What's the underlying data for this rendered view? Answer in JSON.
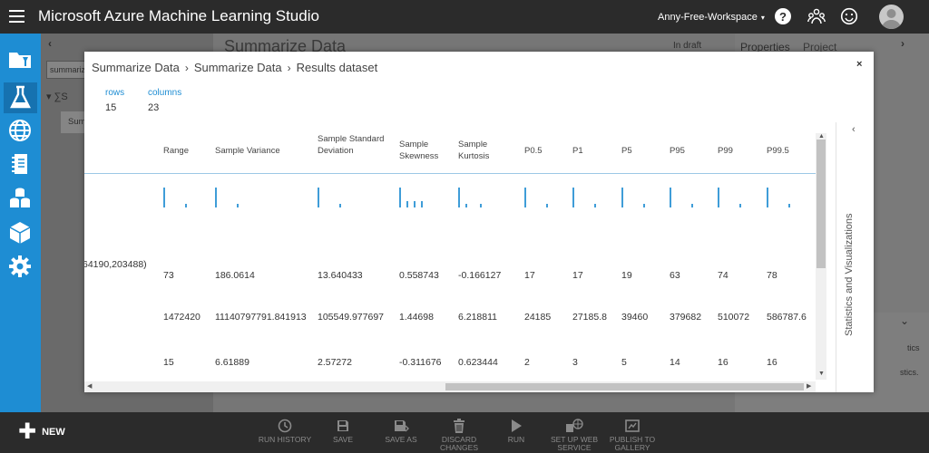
{
  "app": {
    "title": "Microsoft Azure Machine Learning Studio",
    "workspace": "Anny-Free-Workspace",
    "workspace_caret": "▾",
    "help_glyph": "?"
  },
  "background": {
    "search_value": "summariz",
    "tree_item": "S",
    "tree_selected": "Sum",
    "canvas_title": "Summarize Data",
    "status": "In draft",
    "tab_properties": "Properties",
    "tab_project": "Project",
    "props_text_1": "tics",
    "props_text_2": "stics."
  },
  "modal": {
    "breadcrumb": [
      "Summarize Data",
      "Summarize Data",
      "Results dataset"
    ],
    "breadcrumb_sep": "›",
    "close": "×",
    "rows_label": "rows",
    "rows_value": "15",
    "columns_label": "columns",
    "columns_value": "23",
    "side_panel_label": "Statistics and Visualizations",
    "side_panel_chevron": "‹",
    "columns": [
      {
        "header": "Range",
        "hist": [
          1,
          0,
          0,
          0.2
        ],
        "values": [
          "73",
          "1472420",
          "15"
        ]
      },
      {
        "header": "Sample Variance",
        "hist": [
          1,
          0,
          0,
          0.2
        ],
        "values": [
          "186.0614",
          "11140797791.841913",
          "6.61889"
        ]
      },
      {
        "header": "Sample Standard Deviation",
        "hist": [
          1,
          0,
          0,
          0.2
        ],
        "values": [
          "13.640433",
          "105549.977697",
          "2.57272"
        ]
      },
      {
        "header": "Sample Skewness",
        "hist": [
          1,
          0.3,
          0.3,
          0.3
        ],
        "values": [
          "0.558743",
          "1.44698",
          "-0.311676"
        ]
      },
      {
        "header": "Sample Kurtosis",
        "hist": [
          1,
          0.2,
          0,
          0.2
        ],
        "values": [
          "-0.166127",
          "6.218811",
          "0.623444"
        ]
      },
      {
        "header": "P0.5",
        "hist": [
          1,
          0,
          0,
          0.2
        ],
        "values": [
          "17",
          "24185",
          "2"
        ]
      },
      {
        "header": "P1",
        "hist": [
          1,
          0,
          0,
          0.2
        ],
        "values": [
          "17",
          "27185.8",
          "3"
        ]
      },
      {
        "header": "P5",
        "hist": [
          1,
          0,
          0,
          0.2
        ],
        "values": [
          "19",
          "39460",
          "5"
        ]
      },
      {
        "header": "P95",
        "hist": [
          1,
          0,
          0,
          0.2
        ],
        "values": [
          "63",
          "379682",
          "14"
        ]
      },
      {
        "header": "P99",
        "hist": [
          1,
          0,
          0,
          0.2
        ],
        "values": [
          "74",
          "510072",
          "16"
        ]
      },
      {
        "header": "P99.5",
        "hist": [
          1,
          0,
          0,
          0.2
        ],
        "values": [
          "78",
          "586787.6",
          "16"
        ]
      }
    ],
    "partial_cell": "64190,203488)"
  },
  "bottombar": {
    "new_label": "NEW",
    "commands": [
      {
        "label": "RUN HISTORY",
        "icon": "clock-icon"
      },
      {
        "label": "SAVE",
        "icon": "save-icon"
      },
      {
        "label": "SAVE AS",
        "icon": "save-as-icon"
      },
      {
        "label": "DISCARD CHANGES",
        "icon": "trash-icon"
      },
      {
        "label": "RUN",
        "icon": "play-icon"
      },
      {
        "label": "SET UP WEB SERVICE",
        "icon": "web-service-icon"
      },
      {
        "label": "PUBLISH TO GALLERY",
        "icon": "gallery-icon"
      }
    ]
  },
  "colors": {
    "accent": "#1e8dd3",
    "bar": "#3f9dd8",
    "topbar": "#2b2b2b"
  }
}
